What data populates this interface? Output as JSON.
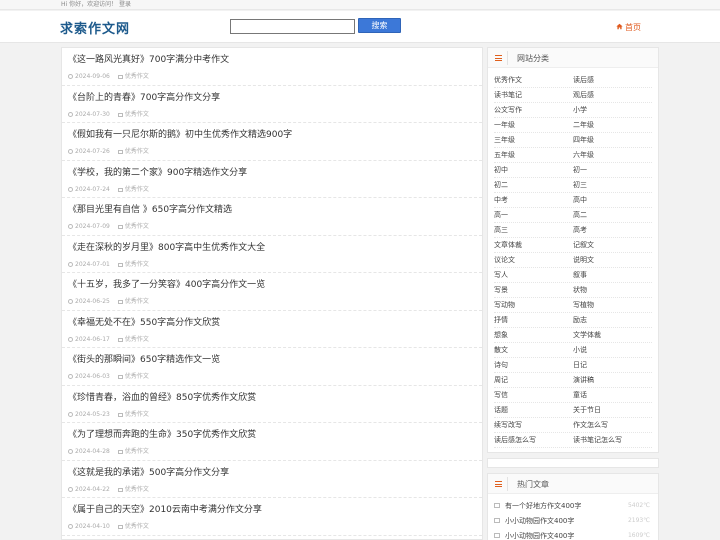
{
  "topbar": {
    "greeting": "Hi 你好，欢迎访问！",
    "login": "登录"
  },
  "header": {
    "logo": "求索作文网",
    "search_placeholder": "",
    "search_button": "搜索",
    "home_label": "首页",
    "home_icon": "house-icon"
  },
  "articles": [
    {
      "title": "《这一路风光真好》700字满分中考作文",
      "date": "2024-09-06",
      "category": "优秀作文"
    },
    {
      "title": "《台阶上的青春》700字高分作文分享",
      "date": "2024-07-30",
      "category": "优秀作文"
    },
    {
      "title": "《假如我有一只尼尔斯的鹅》初中生优秀作文精选900字",
      "date": "2024-07-26",
      "category": "优秀作文"
    },
    {
      "title": "《学校，我的第二个家》900字精选作文分享",
      "date": "2024-07-24",
      "category": "优秀作文"
    },
    {
      "title": "《那目光里有自信 》650字高分作文精选",
      "date": "2024-07-09",
      "category": "优秀作文"
    },
    {
      "title": "《走在深秋的岁月里》800字高中生优秀作文大全",
      "date": "2024-07-01",
      "category": "优秀作文"
    },
    {
      "title": "《十五岁，我多了一分笑容》400字高分作文一览",
      "date": "2024-06-25",
      "category": "优秀作文"
    },
    {
      "title": "《幸福无处不在》550字高分作文欣赏",
      "date": "2024-06-17",
      "category": "优秀作文"
    },
    {
      "title": "《街头的那瞬间》650字精选作文一览",
      "date": "2024-06-03",
      "category": "优秀作文"
    },
    {
      "title": "《珍惜青春，浴血的曾经》850字优秀作文欣赏",
      "date": "2024-05-23",
      "category": "优秀作文"
    },
    {
      "title": "《为了理想而奔跑的生命》350字优秀作文欣赏",
      "date": "2024-04-28",
      "category": "优秀作文"
    },
    {
      "title": "《这就是我的承诺》500字高分作文分享",
      "date": "2024-04-22",
      "category": "优秀作文"
    },
    {
      "title": "《属于自己的天空》2010云南中考满分作文分享",
      "date": "2024-04-10",
      "category": "优秀作文"
    }
  ],
  "categories_panel": {
    "title": "网站分类",
    "icon": "menu-icon",
    "rows": [
      [
        "优秀作文",
        "读后感"
      ],
      [
        "读书笔记",
        "观后感"
      ],
      [
        "公文写作",
        "小学"
      ],
      [
        "一年级",
        "二年级"
      ],
      [
        "三年级",
        "四年级"
      ],
      [
        "五年级",
        "六年级"
      ],
      [
        "初中",
        "初一"
      ],
      [
        "初二",
        "初三"
      ],
      [
        "中考",
        "高中"
      ],
      [
        "高一",
        "高二"
      ],
      [
        "高三",
        "高考"
      ],
      [
        "文章体裁",
        "记叙文"
      ],
      [
        "议论文",
        "说明文"
      ],
      [
        "写人",
        "叙事"
      ],
      [
        "写景",
        "状物"
      ],
      [
        "写动物",
        "写植物"
      ],
      [
        "抒情",
        "励志"
      ],
      [
        "想象",
        "文学体裁"
      ],
      [
        "散文",
        "小说"
      ],
      [
        "诗句",
        "日记"
      ],
      [
        "周记",
        "演讲稿"
      ],
      [
        "写信",
        "童话"
      ],
      [
        "话题",
        "关于节日"
      ],
      [
        "续写改写",
        "作文怎么写"
      ],
      [
        "读后感怎么写",
        "读书笔记怎么写"
      ]
    ]
  },
  "hot_panel": {
    "title": "热门文章",
    "icon": "menu-icon",
    "items": [
      {
        "title": "有一个好地方作文400字",
        "count": "5402℃"
      },
      {
        "title": "小小动物园作文400字",
        "count": "2193℃"
      },
      {
        "title": "小小动物园作文400字",
        "count": "1609℃"
      }
    ]
  }
}
